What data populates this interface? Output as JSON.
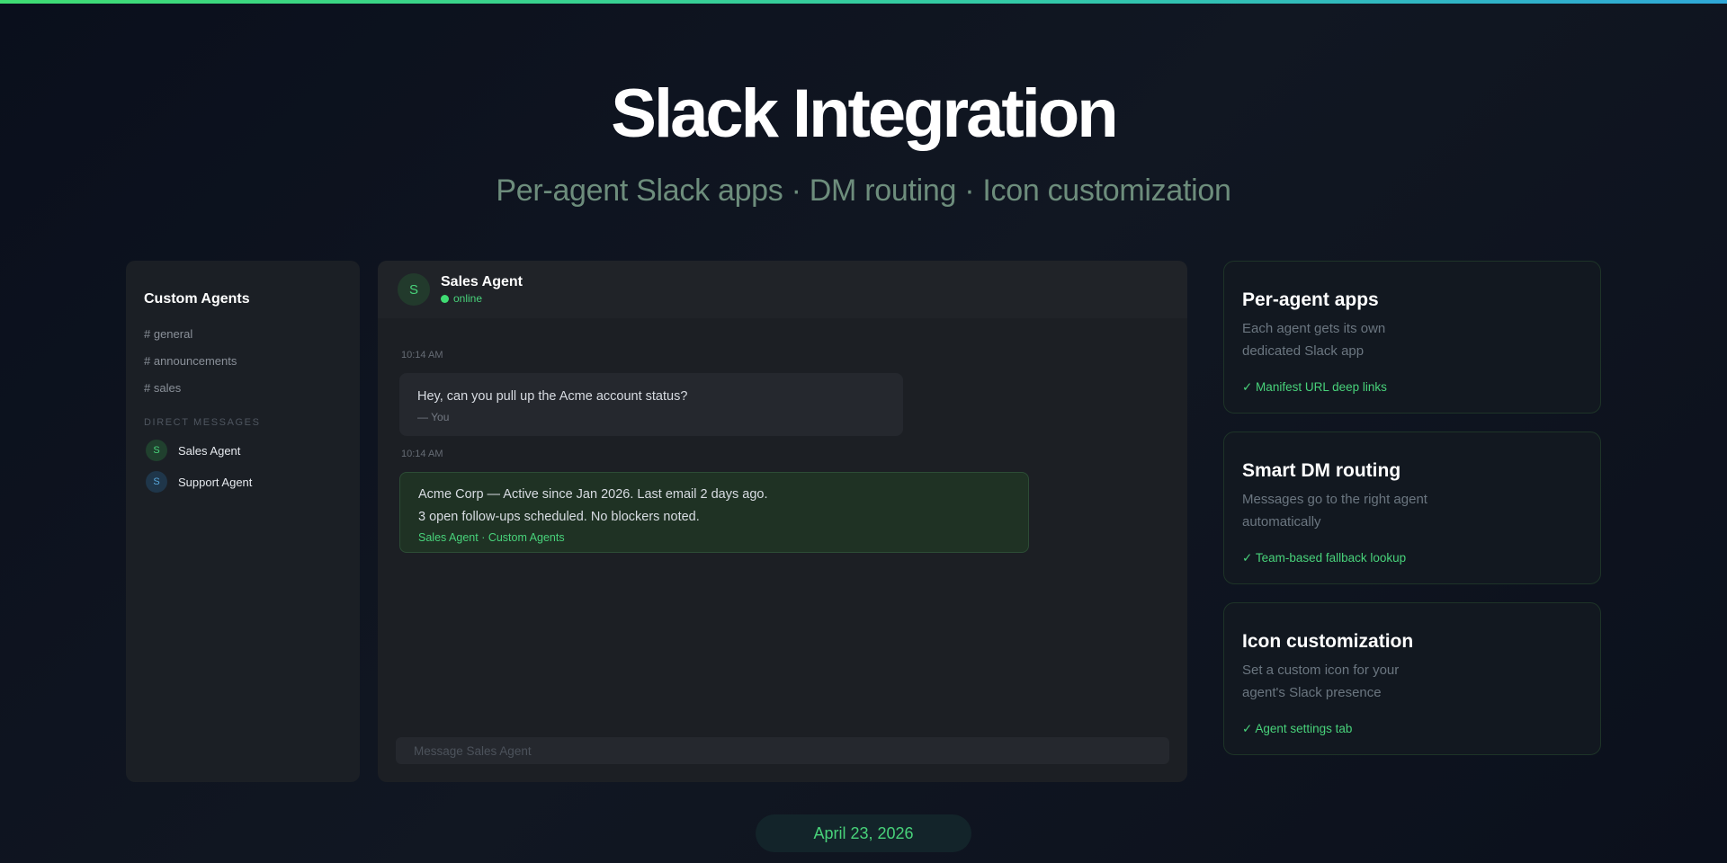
{
  "hero": {
    "title": "Slack Integration",
    "subtitle": "Per-agent Slack apps · DM routing · Icon customization"
  },
  "sidebar": {
    "title": "Custom Agents",
    "channels": [
      "# general",
      "# announcements",
      "# sales"
    ],
    "dm_header": "DIRECT MESSAGES",
    "dms": [
      {
        "initial": "S",
        "label": "Sales Agent"
      },
      {
        "initial": "S",
        "label": "Support Agent"
      }
    ]
  },
  "chat": {
    "avatar_initial": "S",
    "name": "Sales Agent",
    "status": "online",
    "messages": [
      {
        "time": "10:14 AM",
        "text": "Hey, can you pull up the Acme account status?",
        "sender": "— You"
      },
      {
        "time": "10:14 AM",
        "line1": "Acme Corp — Active since Jan 2026. Last email 2 days ago.",
        "line2": "3 open follow-ups scheduled. No blockers noted.",
        "sender": "Sales Agent · Custom Agents"
      }
    ],
    "composer_placeholder": "Message Sales Agent"
  },
  "cards": [
    {
      "title": "Per-agent apps",
      "desc": "Each agent gets its own dedicated Slack app",
      "feature": "✓ Manifest URL deep links"
    },
    {
      "title": "Smart DM routing",
      "desc": "Messages go to the right agent automatically",
      "feature": "✓ Team-based fallback lookup"
    },
    {
      "title": "Icon customization",
      "desc": "Set a custom icon for your agent's Slack presence",
      "feature": "✓ Agent settings tab"
    }
  ],
  "footer": {
    "date": "April 23, 2026"
  },
  "colors": {
    "accent": "#3fdc73",
    "background": "#0a0f1c"
  }
}
